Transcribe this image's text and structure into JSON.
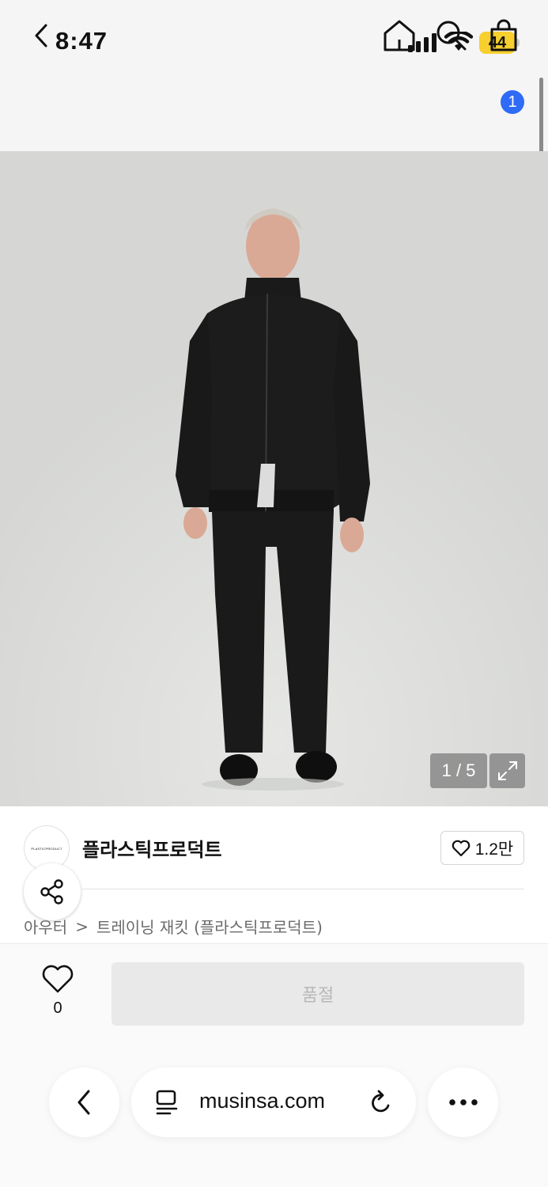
{
  "status_bar": {
    "time": "8:47",
    "battery": "44",
    "icons": [
      "cellular-signal-icon",
      "wifi-icon",
      "battery-icon"
    ]
  },
  "nav": {
    "icons": [
      "back-icon",
      "home-icon",
      "search-icon",
      "shopping-bag-icon"
    ],
    "cart_count": "1"
  },
  "gallery": {
    "counter": "1 / 5",
    "icons": [
      "expand-icon"
    ]
  },
  "brand": {
    "logo_text": "PLASTICPRODUCT",
    "name": "플라스틱프로덕트",
    "like_count": "1.2만",
    "icons": [
      "heart-outline-icon",
      "share-icon"
    ]
  },
  "breadcrumb": {
    "category": "아우터",
    "separator": ">",
    "product": "트레이닝 재킷 (플라스틱프로덕트)"
  },
  "purchase": {
    "wish_count": "0",
    "soldout_label": "품절"
  },
  "browser": {
    "url": "musinsa.com",
    "icons": [
      "browser-back-icon",
      "reader-icon",
      "reload-icon",
      "more-icon"
    ]
  },
  "colors": {
    "badge": "#2f6bf7",
    "battery": "#f7cf2e",
    "soldout_bg": "#e9e9e9",
    "soldout_text": "#b8b8b8"
  }
}
